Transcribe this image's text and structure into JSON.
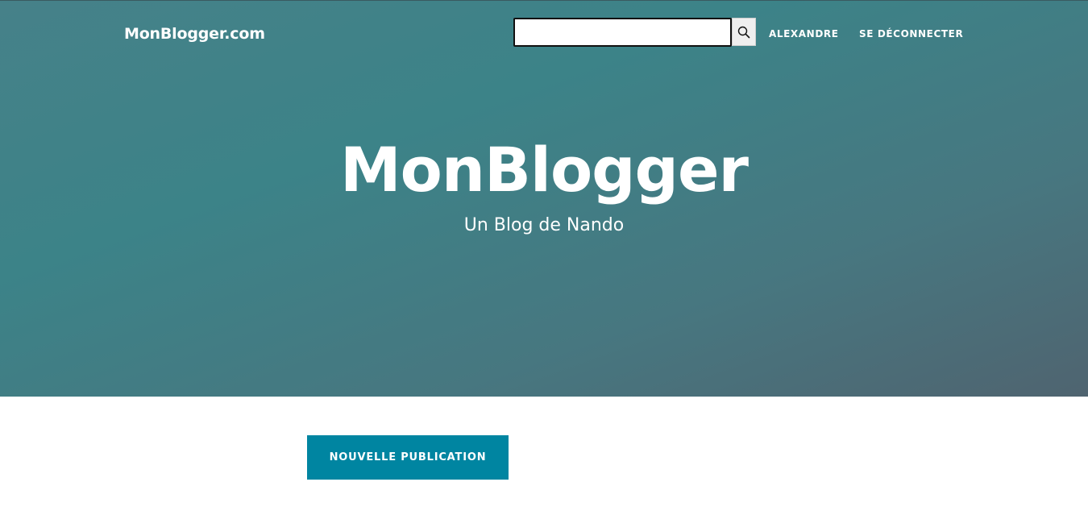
{
  "nav": {
    "brand": "MonBlogger.com",
    "search": {
      "value": "",
      "icon": "search-icon"
    },
    "user_link": "ALEXANDRE",
    "logout_link": "SE DÉCONNECTER"
  },
  "hero": {
    "title": "MonBlogger",
    "subtitle": "Un Blog de Nando"
  },
  "main": {
    "new_post_button": "NOUVELLE PUBLICATION"
  },
  "colors": {
    "hero_start": "#468189",
    "hero_end": "#4f6470",
    "accent_button": "#0085a1",
    "text_light": "#ffffff"
  }
}
